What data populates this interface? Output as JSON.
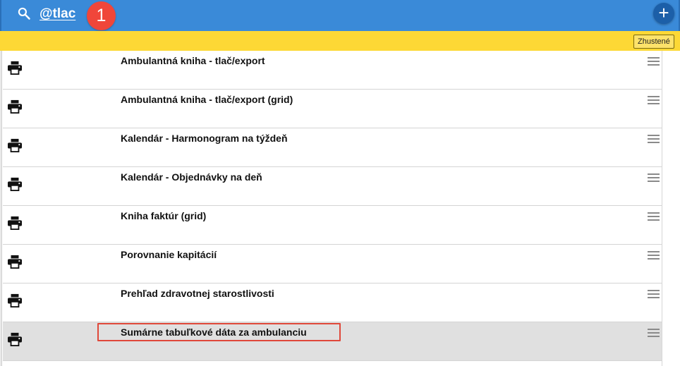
{
  "header": {
    "search_query": "@tlac",
    "step_badge": "1",
    "add_label": "+"
  },
  "toolbar": {
    "compact_label": "Zhustené"
  },
  "list": {
    "items": [
      {
        "label": "Ambulantná kniha - tlač/export",
        "icon": "printer-icon"
      },
      {
        "label": "Ambulantná kniha - tlač/export (grid)",
        "icon": "printer-icon"
      },
      {
        "label": "Kalendár - Harmonogram na týždeň",
        "icon": "printer-icon"
      },
      {
        "label": "Kalendár - Objednávky na deň",
        "icon": "printer-icon"
      },
      {
        "label": "Kniha faktúr (grid)",
        "icon": "printer-icon"
      },
      {
        "label": "Porovnanie kapitácií",
        "icon": "printer-icon"
      },
      {
        "label": "Prehľad zdravotnej starostlivosti",
        "icon": "printer-icon"
      },
      {
        "label": "Sumárne tabuľkové dáta za ambulanciu",
        "icon": "printer-icon",
        "selected": true
      }
    ]
  },
  "colors": {
    "header_bg": "#3a8ad8",
    "badge": "#f0463a",
    "filter_bar": "#fdd835",
    "highlight": "#e0483a",
    "selected_row": "#e0e0e0"
  }
}
